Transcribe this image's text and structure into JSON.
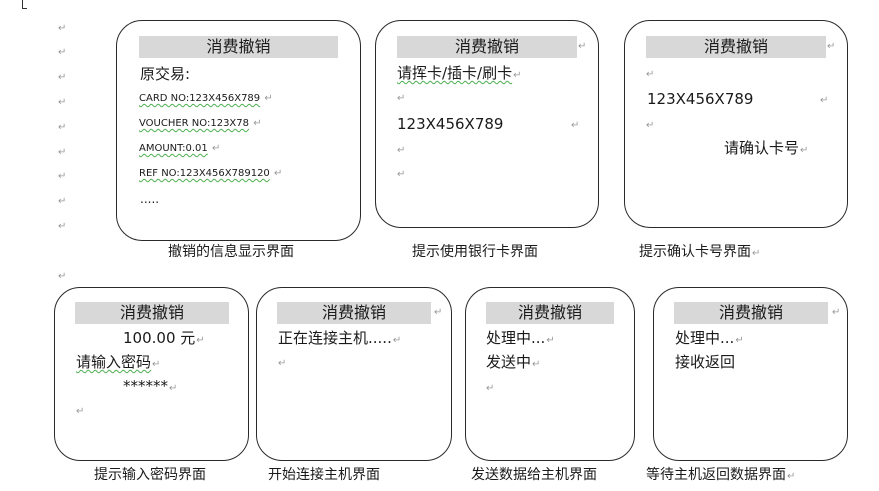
{
  "para_mark": "↵",
  "screen_title": "消费撤销",
  "screens": [
    {
      "caption": "撤销的信息显示界面",
      "lines": [
        "原交易:",
        "CARD NO:123X456X789",
        "VOUCHER    NO:123X78",
        "AMOUNT:0.01",
        "REF NO:123X456X789120",
        "....."
      ]
    },
    {
      "caption": "提示使用银行卡界面",
      "lines": [
        "请挥卡/插卡/刷卡",
        "123X456X789"
      ]
    },
    {
      "caption": "提示确认卡号界面",
      "lines": [
        "123X456X789",
        "请确认卡号"
      ]
    },
    {
      "caption": "提示输入密码界面",
      "lines": [
        "100.00 元",
        "请输入密码",
        "******"
      ]
    },
    {
      "caption": "开始连接主机界面",
      "lines": [
        "正在连接主机....."
      ]
    },
    {
      "caption": "发送数据给主机界面",
      "lines": [
        "处理中...",
        "发送中"
      ]
    },
    {
      "caption": "等待主机返回数据界面",
      "lines": [
        "处理中...",
        "接收返回"
      ]
    }
  ]
}
